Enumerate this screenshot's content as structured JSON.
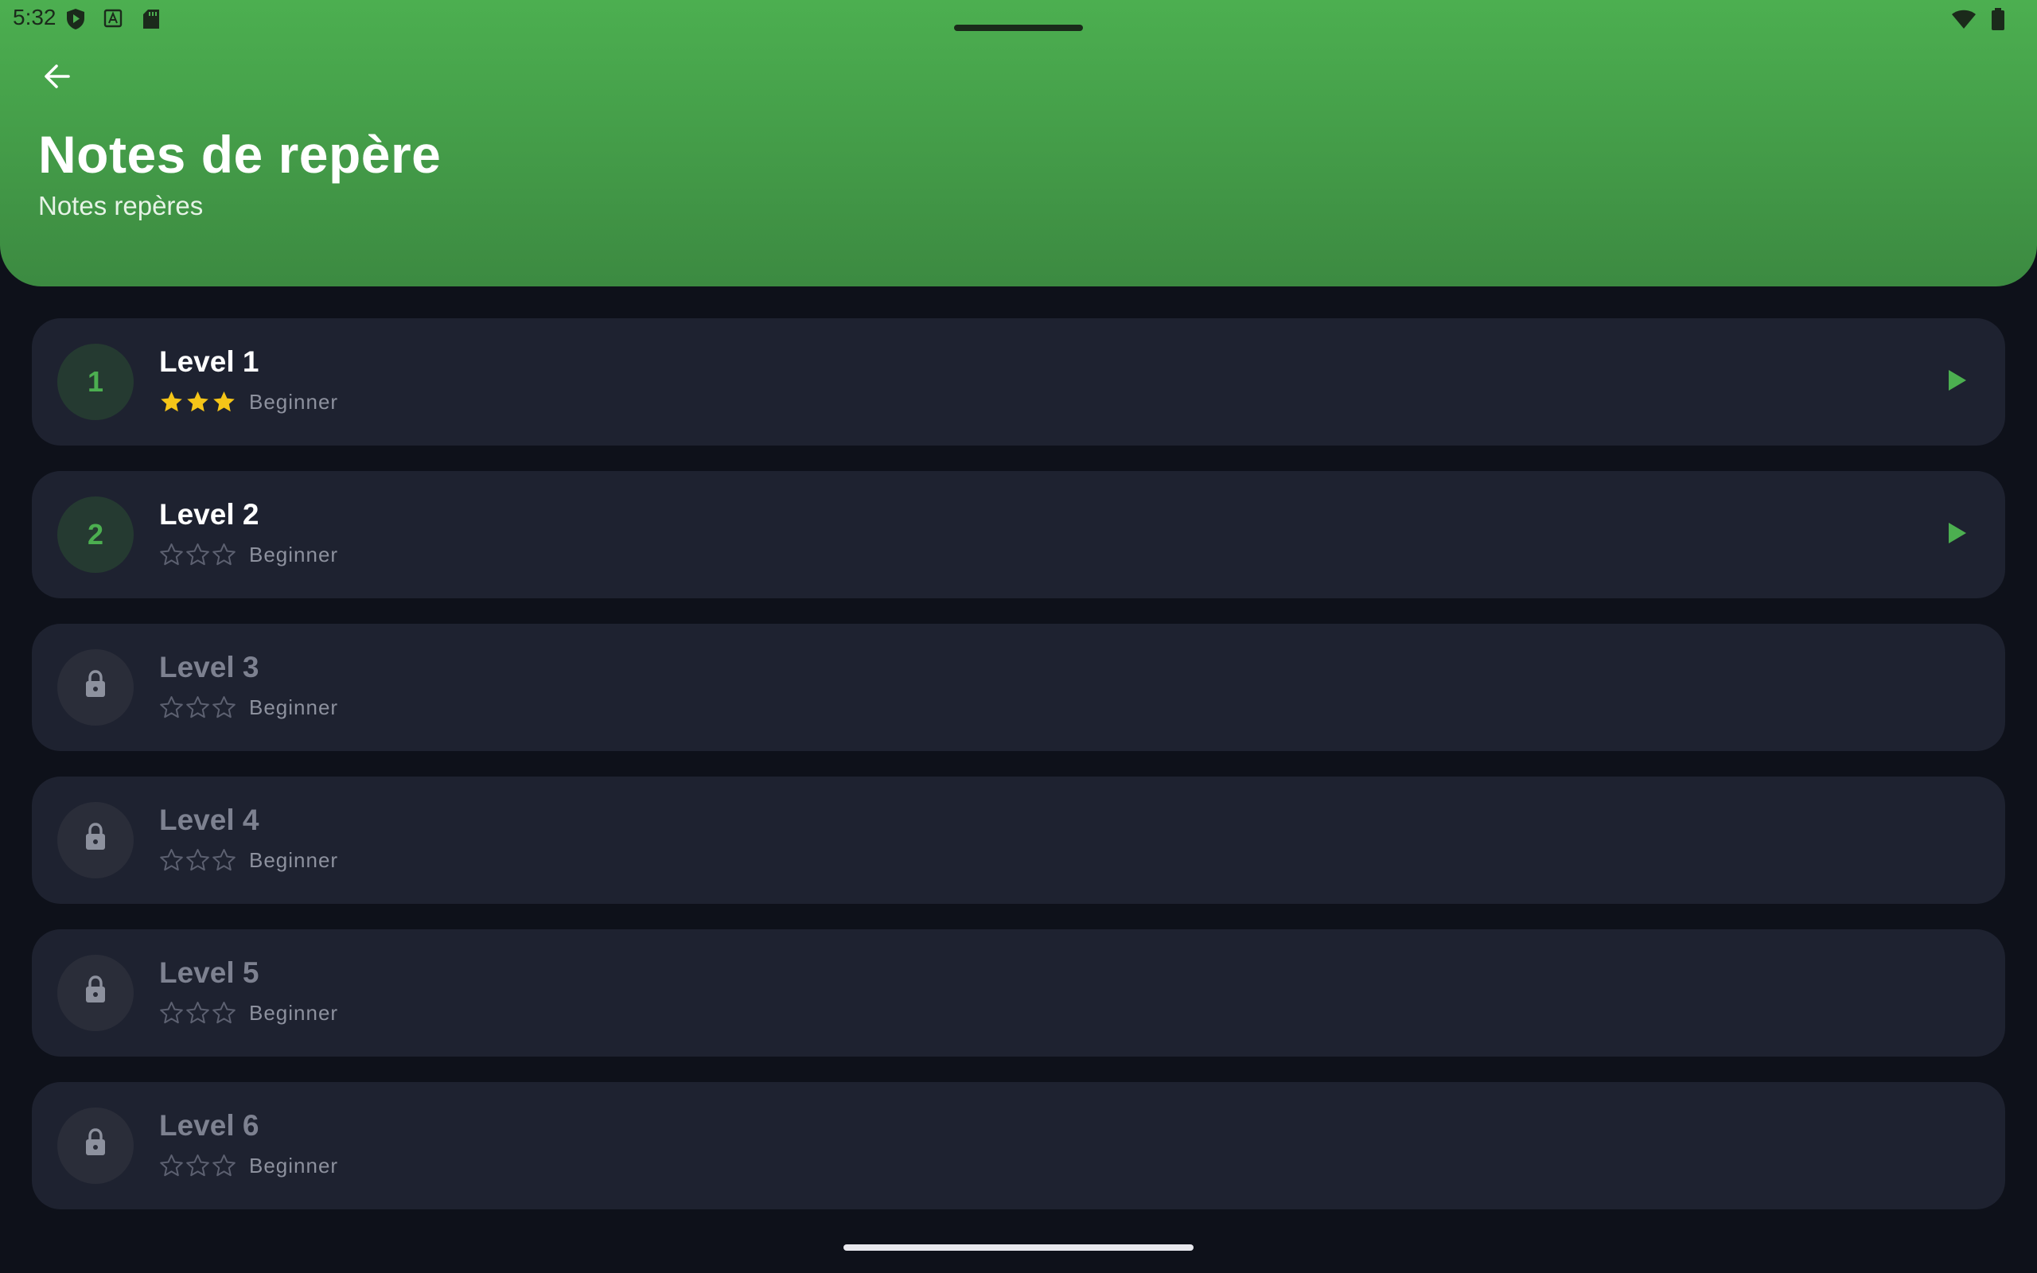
{
  "status_bar": {
    "time": "5:32",
    "left_icons": [
      "shield-play-icon",
      "font-a-icon",
      "sd-card-icon"
    ],
    "right_icons": [
      "wifi-icon",
      "battery-icon"
    ]
  },
  "header": {
    "title": "Notes de repère",
    "subtitle": "Notes repères",
    "back_icon": "arrow-back-icon",
    "gradient_top": "#4caf50",
    "gradient_bottom": "#3c8a41"
  },
  "colors": {
    "accent": "#4caf50",
    "background": "#0e111a",
    "card": "#1e2230",
    "star_filled": "#f5c518",
    "star_empty": "#5c6070",
    "locked_text": "#7d8190"
  },
  "levels": [
    {
      "number": "1",
      "title": "Level 1",
      "difficulty": "Beginner",
      "stars_earned": 3,
      "stars_total": 3,
      "locked": false
    },
    {
      "number": "2",
      "title": "Level 2",
      "difficulty": "Beginner",
      "stars_earned": 0,
      "stars_total": 3,
      "locked": false
    },
    {
      "number": "3",
      "title": "Level 3",
      "difficulty": "Beginner",
      "stars_earned": 0,
      "stars_total": 3,
      "locked": true
    },
    {
      "number": "4",
      "title": "Level 4",
      "difficulty": "Beginner",
      "stars_earned": 0,
      "stars_total": 3,
      "locked": true
    },
    {
      "number": "5",
      "title": "Level 5",
      "difficulty": "Beginner",
      "stars_earned": 0,
      "stars_total": 3,
      "locked": true
    },
    {
      "number": "6",
      "title": "Level 6",
      "difficulty": "Beginner",
      "stars_earned": 0,
      "stars_total": 3,
      "locked": true
    }
  ]
}
